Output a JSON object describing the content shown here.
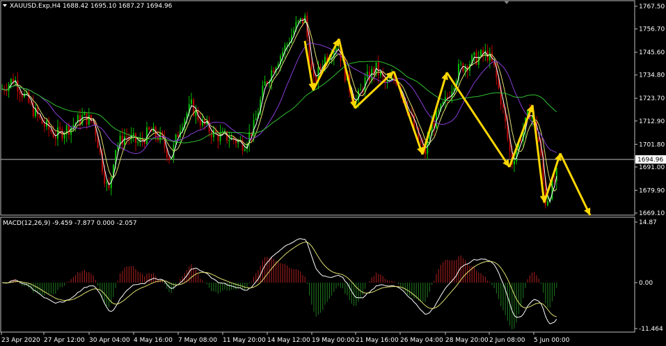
{
  "header": {
    "symbol_line": "XAUUSD.Exp,H4  1688.42 1695.10 1687.27 1694.96",
    "macd_line": "MACD(12,26,9) -9.459 -7.877 0.000 -2.057"
  },
  "current_price": "1694.96",
  "price_scale": [
    "1767.50",
    "1756.70",
    "1745.60",
    "1734.80",
    "1723.70",
    "1712.90",
    "1701.80",
    "1691.00",
    "1679.90",
    "1669.10"
  ],
  "macd_scale": [
    "14.87",
    "0.00",
    "-11.464"
  ],
  "time_labels": [
    "23 Apr 2020",
    "27 Apr 12:00",
    "30 Apr 04:00",
    "4 May 16:00",
    "7 May 08:00",
    "11 May 20:00",
    "14 May 12:00",
    "19 May 00:00",
    "21 May 16:00",
    "26 May 04:00",
    "28 May 20:00",
    "2 Jun 08:00",
    "5 Jun 00:00"
  ],
  "colors": {
    "background": "#000000",
    "bull_candle": "#00c000",
    "bear_candle": "#c00000",
    "grid_line": "#c0c0c0",
    "arrow": "#ffd700",
    "ma_white": "#ffffff",
    "ma_yellow": "#e0e070",
    "ma_purple": "#8a3cd8",
    "ma_green": "#30c030",
    "hist_up": "#b02020",
    "hist_down": "#207a20"
  },
  "chart_data": {
    "type": "line",
    "instrument": "XAUUSD.Exp",
    "timeframe": "H4",
    "price_range": [
      1669.1,
      1767.5
    ],
    "macd_range": [
      -11.464,
      14.87
    ],
    "arrow_path_prices": [
      1751.0,
      1727.5,
      1752.0,
      1719.0,
      1736.5,
      1697.0,
      1736.0,
      1691.0,
      1720.5,
      1674.0,
      1697.5,
      1668.0
    ]
  }
}
